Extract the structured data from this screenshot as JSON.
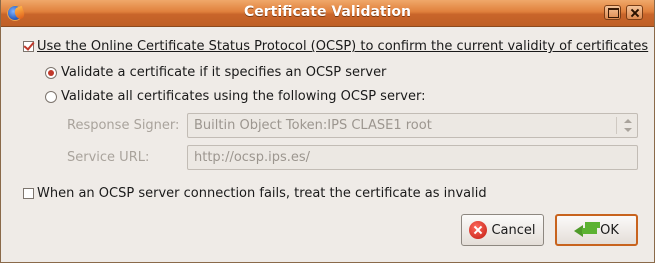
{
  "window": {
    "title": "Certificate Validation"
  },
  "ocsp": {
    "use_label": "Use the Online Certificate Status Protocol (OCSP) to confirm the current validity of certificates",
    "use_checked": true,
    "option_specified_label": "Validate a certificate if it specifies an OCSP server",
    "option_specified_selected": true,
    "option_all_label": "Validate all certificates using the following OCSP server:",
    "option_all_selected": false,
    "signer_label": "Response Signer:",
    "signer_value": "Builtin Object Token:IPS CLASE1 root",
    "url_label": "Service URL:",
    "url_value": "http://ocsp.ips.es/",
    "fail_label": "When an OCSP server connection fails, treat the certificate as invalid",
    "fail_checked": false
  },
  "buttons": {
    "cancel": "Cancel",
    "ok": "OK"
  },
  "icons": {
    "app": "firefox-icon",
    "maximize": "maximize-icon",
    "close": "close-icon",
    "cancel": "cancel-icon",
    "ok": "ok-icon"
  },
  "colors": {
    "titlebar": "#e0803c",
    "accent": "#c0392b",
    "default_border": "#c8631e"
  }
}
